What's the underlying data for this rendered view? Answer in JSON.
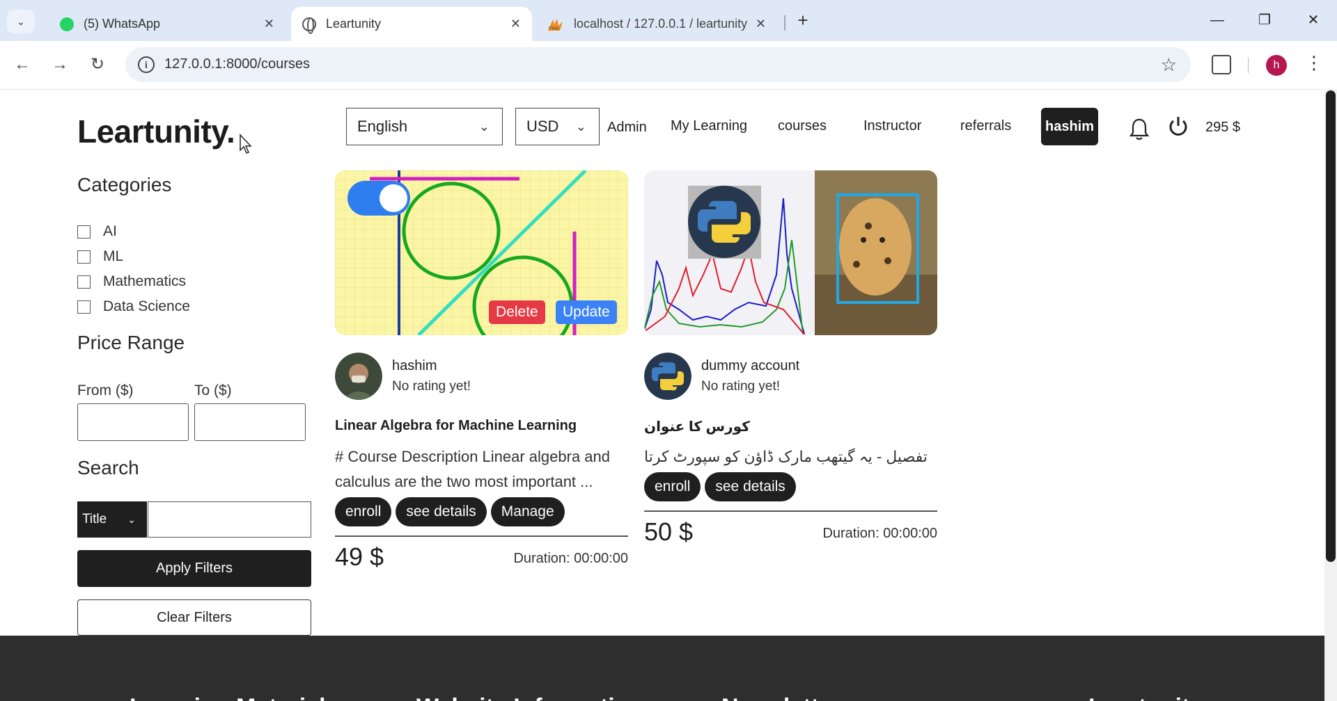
{
  "browser": {
    "tabs": [
      {
        "title": "(5) WhatsApp",
        "icon": "whatsapp-icon"
      },
      {
        "title": "Leartunity",
        "icon": "globe-icon"
      },
      {
        "title": "localhost / 127.0.0.1 / leartunity",
        "icon": "phpmyadmin-icon"
      }
    ],
    "active_tab": 1,
    "url": "127.0.0.1:8000/courses",
    "profile_initial": "h"
  },
  "header": {
    "brand": "Leartunity.",
    "language": "English",
    "currency": "USD",
    "nav": [
      "Admin",
      "My Learning",
      "courses",
      "Instructor",
      "referrals"
    ],
    "user": "hashim",
    "balance": "295 $"
  },
  "sidebar": {
    "categories_heading": "Categories",
    "categories": [
      "AI",
      "ML",
      "Mathematics",
      "Data Science"
    ],
    "price_heading": "Price Range",
    "from_label": "From ($)",
    "to_label": "To ($)",
    "search_heading": "Search",
    "search_field": "Title",
    "apply_label": "Apply Filters",
    "clear_label": "Clear Filters"
  },
  "courses": [
    {
      "author": "hashim",
      "rating": "No rating yet!",
      "title": "Linear Algebra for Machine Learning",
      "description": "# Course Description Linear algebra and calculus are the two most important ...",
      "actions": [
        "enroll",
        "see details",
        "Manage"
      ],
      "overlay_actions": [
        "Delete",
        "Update"
      ],
      "price": "49 $",
      "duration": "Duration: 00:00:00"
    },
    {
      "author": "dummy account",
      "rating": "No rating yet!",
      "title": "کورس کا عنوان",
      "description": "تفصیل - یہ گیتھب مارک ڈاؤن کو سپورٹ کرتا ہے۔ ...",
      "actions": [
        "enroll",
        "see details"
      ],
      "price": "50 $",
      "duration": "Duration: 00:00:00"
    }
  ],
  "footer": {
    "headings": [
      "Learning Materials",
      "Website Information",
      "Newsletter",
      "Leartunity"
    ]
  },
  "colors": {
    "dark": "#1f1f1f",
    "delete": "#e53945",
    "update": "#3b82f6",
    "tabbar": "#dfe8f6"
  }
}
